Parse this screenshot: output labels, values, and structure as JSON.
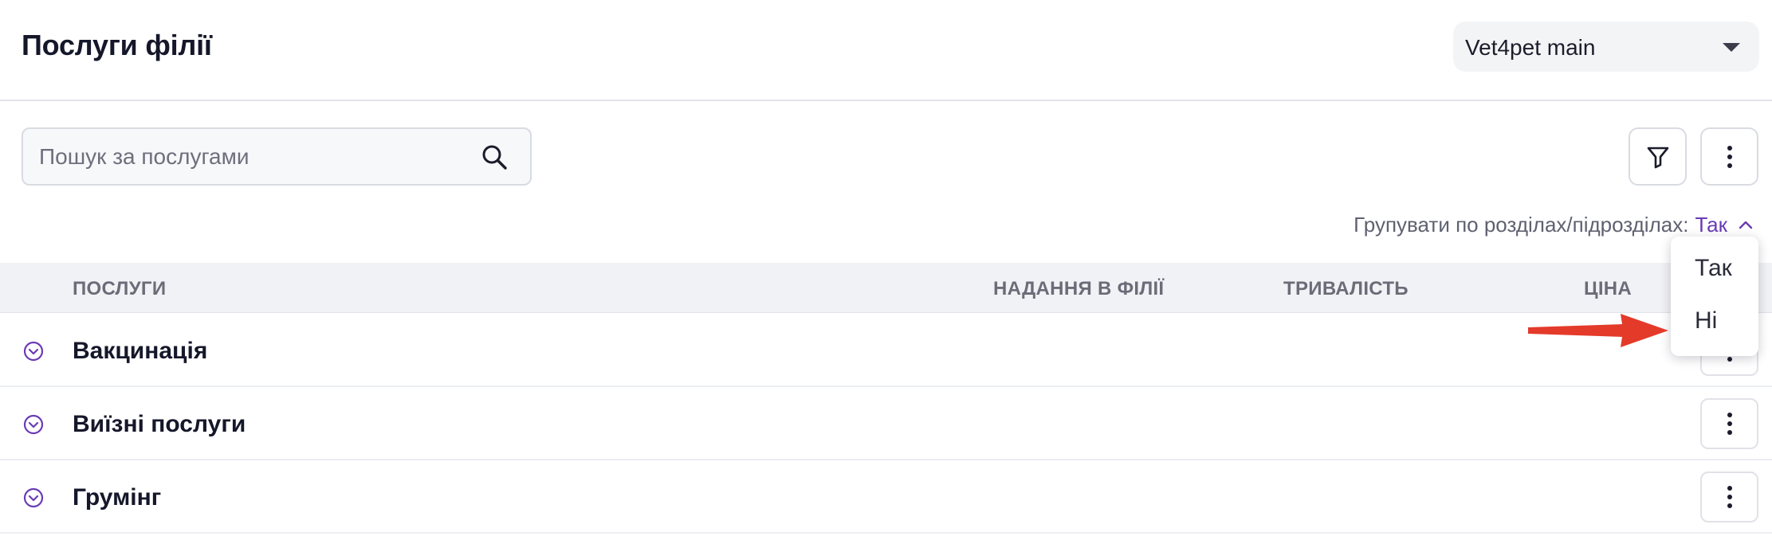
{
  "header": {
    "title": "Послуги філії",
    "branch_select": {
      "value": "Vet4pet main"
    }
  },
  "toolbar": {
    "search": {
      "placeholder": "Пошук за послугами",
      "value": ""
    },
    "group_by": {
      "label": "Групувати по розділах/підрозділах:",
      "value": "Так"
    }
  },
  "table": {
    "columns": [
      "ПОСЛУГИ",
      "НАДАННЯ В ФІЛІЇ",
      "ТРИВАЛІСТЬ",
      "ЦІНА"
    ],
    "rows": [
      {
        "name": "Вакцинація"
      },
      {
        "name": "Виїзні послуги"
      },
      {
        "name": "Грумінг"
      }
    ]
  },
  "dropdown": {
    "options": [
      "Так",
      "Ні"
    ]
  },
  "colors": {
    "accent": "#6a3bb5",
    "annotation_arrow": "#e43a2a",
    "header_bg": "#f1f2f5"
  },
  "icons": [
    "chevron-down-icon",
    "search-icon",
    "filter-icon",
    "more-vertical-icon",
    "chevron-up-icon",
    "expand-circle-icon",
    "arrow-annotation-icon"
  ]
}
